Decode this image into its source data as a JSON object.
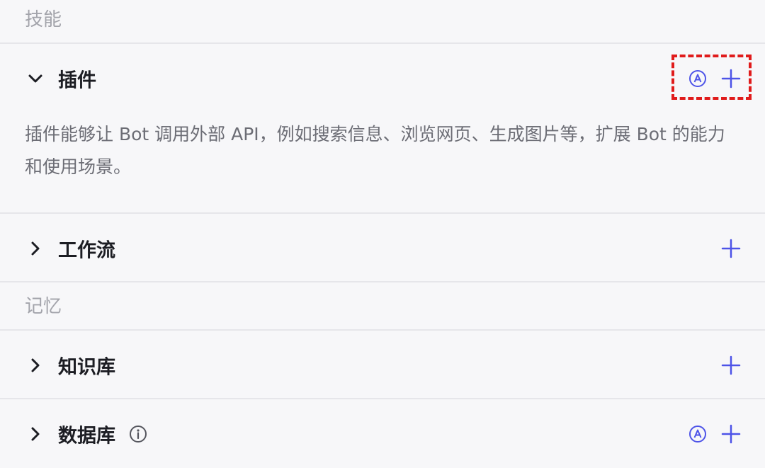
{
  "sections": {
    "skills_label": "技能",
    "memory_label": "记忆"
  },
  "plugins": {
    "title": "插件",
    "description": "插件能够让 Bot 调用外部 API，例如搜索信息、浏览网页、生成图片等，扩展 Bot 的能力和使用场景。",
    "expanded": true
  },
  "workflow": {
    "title": "工作流",
    "expanded": false
  },
  "knowledge": {
    "title": "知识库",
    "expanded": false
  },
  "database": {
    "title": "数据库",
    "expanded": false
  },
  "colors": {
    "accent": "#4d53e8",
    "highlight": "#e01b1b",
    "section_label": "#a3a4ab",
    "divider": "#e6e6ea",
    "background": "#f7f7f9"
  },
  "icons": {
    "expand": "chevron-down-icon",
    "collapse": "chevron-right-icon",
    "auto": "auto-a-icon",
    "add": "plus-icon",
    "info": "info-icon"
  }
}
